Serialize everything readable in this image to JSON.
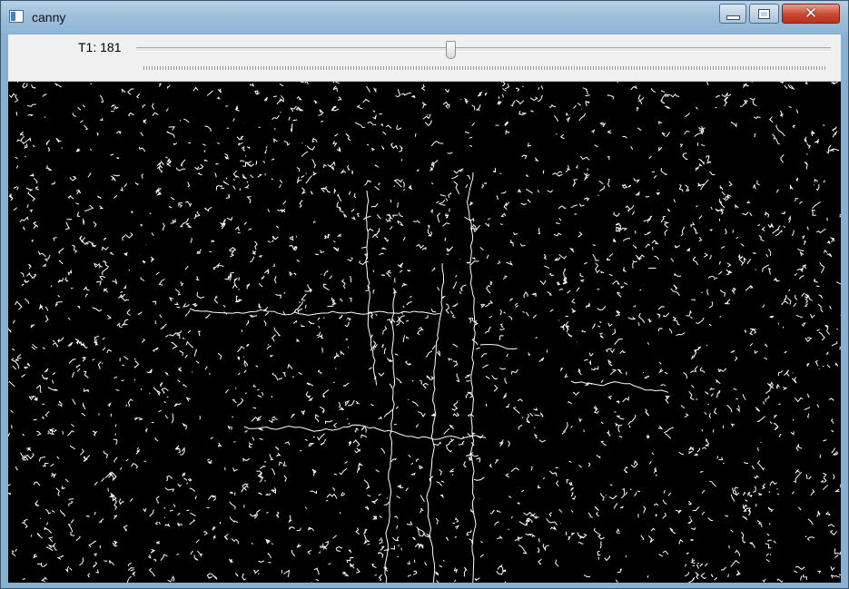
{
  "window": {
    "title": "canny",
    "icon": "app-window-icon",
    "controls": {
      "minimize": "minimize-icon",
      "maximize": "maximize-icon",
      "close_glyph": "✕"
    }
  },
  "trackbar": {
    "label": "T1: 181",
    "value": 181,
    "max": 400
  },
  "image": {
    "description_key": "canny-edge-output",
    "foreground": "#ffffff",
    "background": "#000000"
  }
}
